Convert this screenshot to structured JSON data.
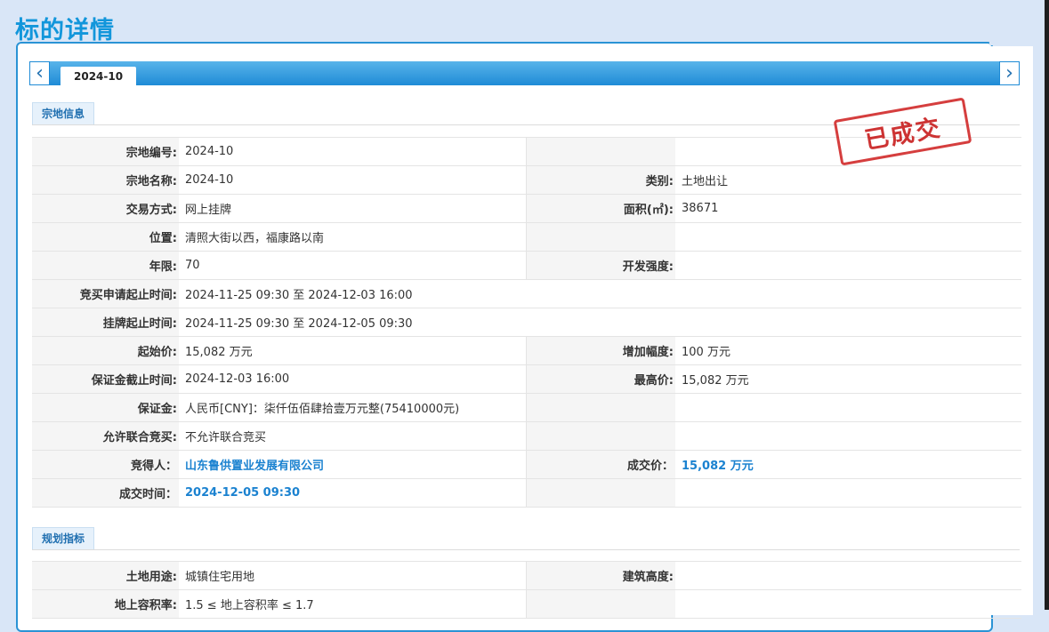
{
  "page_title": "标的详情",
  "tab": {
    "label": "2024-10"
  },
  "nav": {
    "prev_icon": "chevron-left-icon",
    "next_icon": "chevron-right-icon"
  },
  "stamp_text": "已成交",
  "sections": {
    "parcel_info": "宗地信息",
    "planning": "规划指标"
  },
  "parcel": {
    "rows": [
      {
        "l1": "宗地编号:",
        "v1": "2024-10",
        "l2": "",
        "v2": ""
      },
      {
        "l1": "宗地名称:",
        "v1": "2024-10",
        "l2": "类别:",
        "v2": "土地出让"
      },
      {
        "l1": "交易方式:",
        "v1": "网上挂牌",
        "l2": "面积(㎡):",
        "v2": "38671"
      },
      {
        "l1": "位置:",
        "v1": "清照大街以西，福康路以南",
        "l2": "",
        "v2": ""
      },
      {
        "l1": "年限:",
        "v1": "70",
        "l2": "开发强度:",
        "v2": ""
      }
    ],
    "wide_rows": [
      {
        "l": "竞买申请起止时间:",
        "v": "2024-11-25 09:30 至 2024-12-03 16:00"
      },
      {
        "l": "挂牌起止时间:",
        "v": "2024-11-25 09:30 至 2024-12-05 09:30"
      }
    ],
    "rows2": [
      {
        "l1": "起始价:",
        "v1": "15,082 万元",
        "l2": "增加幅度:",
        "v2": "100 万元"
      },
      {
        "l1": "保证金截止时间:",
        "v1": "2024-12-03 16:00",
        "l2": "最高价:",
        "v2": "15,082 万元"
      },
      {
        "l1": "保证金:",
        "v1": "人民币[CNY]：柒仟伍佰肆拾壹万元整(75410000元)",
        "l2": "",
        "v2": ""
      },
      {
        "l1": "允许联合竞买:",
        "v1": "不允许联合竞买",
        "l2": "",
        "v2": ""
      }
    ],
    "result": {
      "winner_label": "竞得人：",
      "winner": "山东鲁供置业发展有限公司",
      "price_label": "成交价：",
      "price": "15,082 万元",
      "time_label": "成交时间：",
      "time": "2024-12-05 09:30"
    }
  },
  "planning": {
    "rows": [
      {
        "l1": "土地用途:",
        "v1": "城镇住宅用地",
        "l2": "建筑高度:",
        "v2": ""
      },
      {
        "l1": "地上容积率:",
        "v1": "1.5 ≤ 地上容积率 ≤ 1.7",
        "l2": "",
        "v2": ""
      }
    ]
  }
}
